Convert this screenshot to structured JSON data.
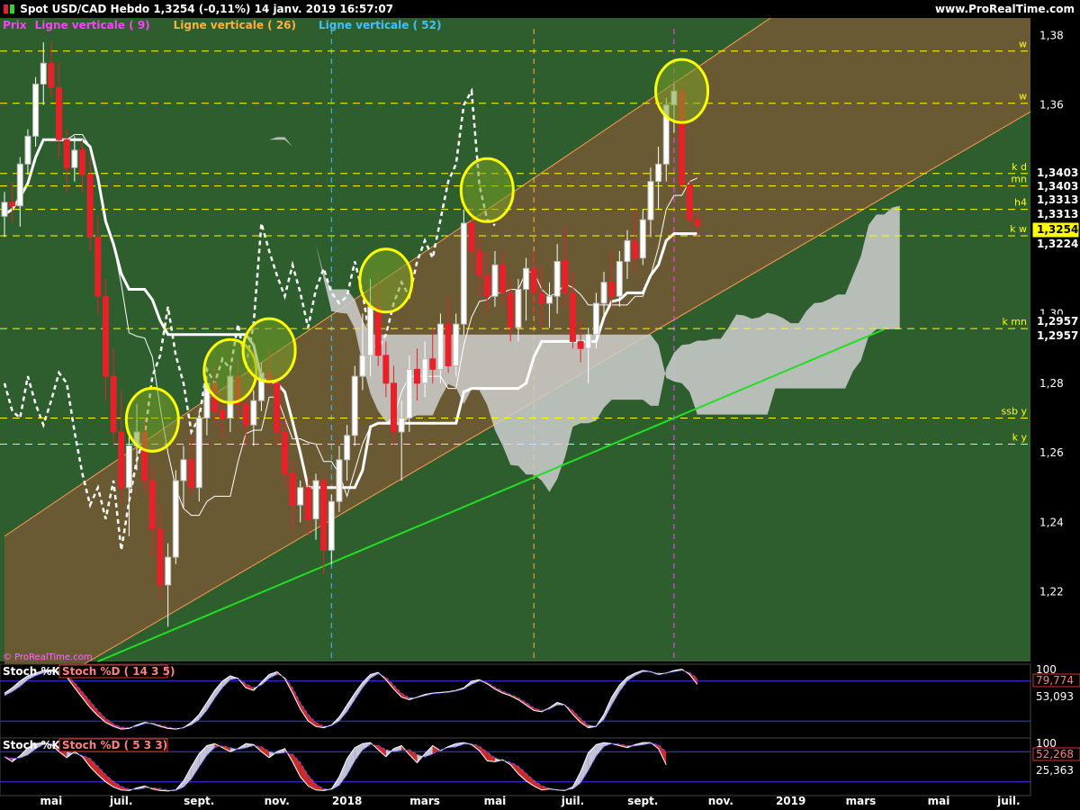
{
  "header": {
    "title": "Spot USD/CAD   Hebdo   1,3254 (-0,11%)   14 janv. 2019 16:57:07",
    "brand": "www.ProRealTime.com",
    "legend": [
      {
        "text": "Prix",
        "color": "#ff40ff"
      },
      {
        "text": "Ligne verticale ( 9)",
        "color": "#ff40ff"
      },
      {
        "text": "Ligne verticale ( 26)",
        "color": "#ffb040"
      },
      {
        "text": "Ligne verticale ( 52)",
        "color": "#40c0ff"
      }
    ],
    "watermark": "© ProRealTime.com"
  },
  "colors": {
    "background": "#2e5e2e",
    "channel": "#6e5a34",
    "up": "#ffffff",
    "down": "#e8202a",
    "level": "#ffff00",
    "trendline": "#22dd22",
    "price_badge": "#ffff00"
  },
  "chart_data": {
    "type": "candlestick",
    "ylim": [
      1.2,
      1.385
    ],
    "yticks": [
      "1,38",
      "1,36",
      "1,34",
      "1,32",
      "1,30",
      "1,28",
      "1,26",
      "1,24",
      "1,22"
    ],
    "xticks": [
      "mai",
      "juil.",
      "sept.",
      "nov.",
      "2018",
      "mars",
      "mai",
      "juil.",
      "sept.",
      "nov.",
      "2019",
      "mars",
      "mai",
      "juil."
    ],
    "start_week": "2017-03-13",
    "candles": [
      [
        1.328,
        1.335,
        1.322,
        1.332
      ],
      [
        1.332,
        1.338,
        1.326,
        1.331
      ],
      [
        1.331,
        1.345,
        1.325,
        1.343
      ],
      [
        1.343,
        1.353,
        1.34,
        1.351
      ],
      [
        1.351,
        1.368,
        1.348,
        1.366
      ],
      [
        1.366,
        1.378,
        1.36,
        1.372
      ],
      [
        1.372,
        1.378,
        1.362,
        1.365
      ],
      [
        1.365,
        1.372,
        1.345,
        1.35
      ],
      [
        1.35,
        1.353,
        1.335,
        1.342
      ],
      [
        1.342,
        1.351,
        1.338,
        1.347
      ],
      [
        1.347,
        1.35,
        1.335,
        1.34
      ],
      [
        1.34,
        1.345,
        1.318,
        1.322
      ],
      [
        1.322,
        1.328,
        1.3,
        1.305
      ],
      [
        1.305,
        1.31,
        1.275,
        1.282
      ],
      [
        1.282,
        1.29,
        1.262,
        1.266
      ],
      [
        1.266,
        1.278,
        1.245,
        1.25
      ],
      [
        1.25,
        1.266,
        1.236,
        1.262
      ],
      [
        1.262,
        1.274,
        1.255,
        1.266
      ],
      [
        1.266,
        1.27,
        1.248,
        1.252
      ],
      [
        1.252,
        1.256,
        1.23,
        1.238
      ],
      [
        1.238,
        1.245,
        1.218,
        1.222
      ],
      [
        1.222,
        1.234,
        1.21,
        1.23
      ],
      [
        1.23,
        1.255,
        1.228,
        1.252
      ],
      [
        1.252,
        1.262,
        1.244,
        1.258
      ],
      [
        1.258,
        1.265,
        1.248,
        1.25
      ],
      [
        1.25,
        1.272,
        1.246,
        1.27
      ],
      [
        1.27,
        1.282,
        1.265,
        1.28
      ],
      [
        1.28,
        1.285,
        1.268,
        1.272
      ],
      [
        1.272,
        1.276,
        1.264,
        1.27
      ],
      [
        1.27,
        1.285,
        1.266,
        1.282
      ],
      [
        1.282,
        1.287,
        1.27,
        1.274
      ],
      [
        1.274,
        1.278,
        1.262,
        1.268
      ],
      [
        1.268,
        1.278,
        1.262,
        1.275
      ],
      [
        1.275,
        1.286,
        1.272,
        1.283
      ],
      [
        1.283,
        1.29,
        1.278,
        1.28
      ],
      [
        1.28,
        1.283,
        1.262,
        1.266
      ],
      [
        1.266,
        1.27,
        1.25,
        1.254
      ],
      [
        1.254,
        1.258,
        1.238,
        1.245
      ],
      [
        1.245,
        1.252,
        1.24,
        1.25
      ],
      [
        1.25,
        1.253,
        1.236,
        1.241
      ],
      [
        1.241,
        1.254,
        1.235,
        1.252
      ],
      [
        1.252,
        1.253,
        1.225,
        1.232
      ],
      [
        1.232,
        1.248,
        1.228,
        1.246
      ],
      [
        1.246,
        1.262,
        1.243,
        1.258
      ],
      [
        1.258,
        1.268,
        1.252,
        1.265
      ],
      [
        1.265,
        1.285,
        1.262,
        1.282
      ],
      [
        1.282,
        1.3,
        1.278,
        1.288
      ],
      [
        1.288,
        1.31,
        1.282,
        1.302
      ],
      [
        1.302,
        1.312,
        1.285,
        1.288
      ],
      [
        1.288,
        1.292,
        1.276,
        1.28
      ],
      [
        1.28,
        1.285,
        1.262,
        1.266
      ],
      [
        1.266,
        1.275,
        1.252,
        1.27
      ],
      [
        1.27,
        1.288,
        1.266,
        1.284
      ],
      [
        1.284,
        1.29,
        1.275,
        1.28
      ],
      [
        1.28,
        1.292,
        1.276,
        1.287
      ],
      [
        1.287,
        1.296,
        1.28,
        1.284
      ],
      [
        1.284,
        1.3,
        1.28,
        1.297
      ],
      [
        1.297,
        1.305,
        1.283,
        1.285
      ],
      [
        1.285,
        1.3,
        1.282,
        1.297
      ],
      [
        1.297,
        1.33,
        1.294,
        1.326
      ],
      [
        1.326,
        1.332,
        1.312,
        1.318
      ],
      [
        1.318,
        1.322,
        1.305,
        1.311
      ],
      [
        1.311,
        1.318,
        1.3,
        1.305
      ],
      [
        1.305,
        1.318,
        1.302,
        1.314
      ],
      [
        1.314,
        1.318,
        1.302,
        1.306
      ],
      [
        1.306,
        1.31,
        1.292,
        1.296
      ],
      [
        1.296,
        1.31,
        1.292,
        1.307
      ],
      [
        1.307,
        1.316,
        1.298,
        1.313
      ],
      [
        1.313,
        1.318,
        1.3,
        1.306
      ],
      [
        1.306,
        1.314,
        1.296,
        1.303
      ],
      [
        1.303,
        1.309,
        1.296,
        1.305
      ],
      [
        1.305,
        1.32,
        1.3,
        1.315
      ],
      [
        1.315,
        1.325,
        1.302,
        1.306
      ],
      [
        1.306,
        1.312,
        1.29,
        1.292
      ],
      [
        1.292,
        1.298,
        1.286,
        1.29
      ],
      [
        1.29,
        1.296,
        1.28,
        1.294
      ],
      [
        1.294,
        1.306,
        1.29,
        1.303
      ],
      [
        1.303,
        1.312,
        1.298,
        1.309
      ],
      [
        1.309,
        1.318,
        1.302,
        1.305
      ],
      [
        1.305,
        1.318,
        1.302,
        1.315
      ],
      [
        1.315,
        1.324,
        1.31,
        1.321
      ],
      [
        1.321,
        1.33,
        1.312,
        1.316
      ],
      [
        1.316,
        1.33,
        1.314,
        1.327
      ],
      [
        1.327,
        1.342,
        1.322,
        1.338
      ],
      [
        1.338,
        1.348,
        1.33,
        1.343
      ],
      [
        1.343,
        1.362,
        1.338,
        1.36
      ],
      [
        1.36,
        1.366,
        1.352,
        1.364
      ],
      [
        1.364,
        1.366,
        1.335,
        1.337
      ],
      [
        1.337,
        1.339,
        1.325,
        1.327
      ],
      [
        1.327,
        1.33,
        1.322,
        1.3254
      ]
    ],
    "levels": [
      {
        "label": "w",
        "value": 1.3755
      },
      {
        "label": "w",
        "value": 1.3605
      },
      {
        "label": "k d",
        "value": 1.3403,
        "badge": "1,3403"
      },
      {
        "label": "mn",
        "value": 1.3367,
        "badge": "1,3403"
      },
      {
        "label": "h4",
        "value": 1.33,
        "badge": "1,3313"
      },
      {
        "label": "k w",
        "value": 1.3224,
        "badge": "1,3224"
      },
      {
        "label": "k mn",
        "value": 1.2957,
        "badge": "1,2957"
      },
      {
        "label": "ssb y",
        "value": 1.27
      },
      {
        "label": "k y",
        "value": 1.2625
      }
    ],
    "badges": [
      "1,3403",
      "1,3403",
      "1,3313",
      "1,3313",
      "1,3254",
      "1,3224",
      "1,2957",
      "1,2957"
    ],
    "last_price": "1,3254",
    "vertical_lines": [
      {
        "week": 42,
        "color": "#40c0ff"
      },
      {
        "week": 68,
        "color": "#ffb040"
      },
      {
        "week": 86,
        "color": "#ff40ff"
      }
    ],
    "trendline": {
      "x": [
        12,
        113
      ],
      "y": [
        1.2,
        1.2955
      ]
    },
    "channel": {
      "lower": {
        "x": [
          20,
          113
        ],
        "y": [
          1.212,
          1.3335
        ]
      },
      "upper": {
        "x": [
          0,
          104
        ],
        "y": [
          1.236,
          1.3935
        ]
      }
    },
    "highlight_circles": [
      {
        "week": 19,
        "value": 1.2695
      },
      {
        "week": 29,
        "value": 1.2835
      },
      {
        "week": 34,
        "value": 1.2895
      },
      {
        "week": 49,
        "value": 1.3095
      },
      {
        "week": 62,
        "value": 1.3355
      },
      {
        "week": 87,
        "value": 1.364
      }
    ],
    "stoch1": {
      "title": "Stoch %K  Stoch %D ( 14 3 5)",
      "top_label": "100",
      "readouts": [
        "79,774",
        "53,093"
      ],
      "k": [
        62,
        70,
        80,
        88,
        92,
        96,
        97,
        94,
        86,
        70,
        55,
        40,
        28,
        18,
        12,
        8,
        9,
        14,
        18,
        16,
        12,
        9,
        8,
        10,
        18,
        30,
        48,
        66,
        80,
        88,
        84,
        70,
        66,
        78,
        90,
        94,
        84,
        62,
        38,
        20,
        12,
        10,
        14,
        26,
        44,
        62,
        78,
        90,
        93,
        82,
        68,
        56,
        52,
        56,
        60,
        62,
        63,
        64,
        66,
        70,
        80,
        82,
        76,
        68,
        62,
        58,
        52,
        44,
        36,
        34,
        40,
        48,
        44,
        30,
        18,
        10,
        12,
        30,
        56,
        74,
        86,
        92,
        96,
        94,
        90,
        92,
        96,
        98,
        90,
        75
      ],
      "d": [
        58,
        64,
        72,
        82,
        88,
        92,
        94,
        93,
        89,
        78,
        64,
        50,
        36,
        24,
        16,
        11,
        10,
        12,
        16,
        17,
        14,
        11,
        9,
        10,
        14,
        22,
        36,
        54,
        70,
        82,
        84,
        76,
        70,
        74,
        84,
        90,
        86,
        70,
        48,
        30,
        18,
        12,
        13,
        20,
        34,
        52,
        70,
        84,
        91,
        86,
        74,
        62,
        55,
        55,
        58,
        61,
        62,
        63,
        65,
        68,
        75,
        80,
        78,
        71,
        65,
        60,
        55,
        48,
        40,
        36,
        38,
        44,
        44,
        36,
        24,
        14,
        12,
        22,
        44,
        64,
        80,
        88,
        94,
        94,
        92,
        92,
        94,
        96,
        93,
        84
      ]
    },
    "stoch2": {
      "title": "Stoch %K  Stoch %D ( 5 3 3)",
      "top_label": "100",
      "readouts": [
        "52,268",
        "25,363"
      ],
      "k": [
        70,
        60,
        72,
        88,
        96,
        98,
        94,
        80,
        68,
        80,
        70,
        50,
        34,
        20,
        10,
        4,
        3,
        8,
        12,
        6,
        3,
        2,
        4,
        22,
        50,
        76,
        92,
        96,
        88,
        80,
        86,
        96,
        94,
        80,
        68,
        80,
        86,
        60,
        30,
        12,
        4,
        3,
        6,
        30,
        66,
        88,
        96,
        98,
        84,
        70,
        86,
        92,
        74,
        58,
        76,
        92,
        82,
        90,
        96,
        98,
        94,
        82,
        62,
        60,
        64,
        54,
        36,
        22,
        12,
        4,
        6,
        4,
        3,
        10,
        40,
        78,
        94,
        98,
        96,
        92,
        88,
        94,
        98,
        98,
        86,
        54
      ]
    }
  }
}
